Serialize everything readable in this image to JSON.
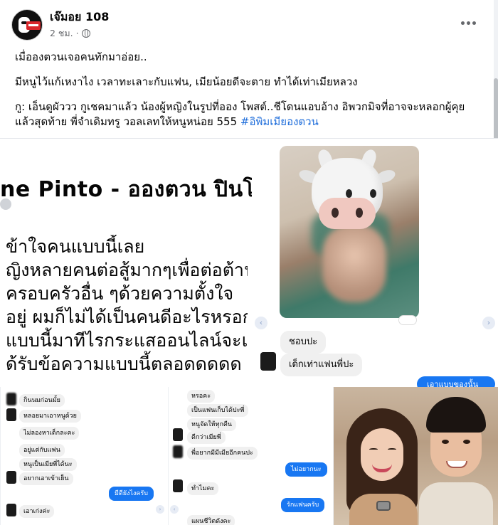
{
  "post": {
    "page_name": "เจ๊มอย 108",
    "time": "2 ชม.",
    "separator": "·",
    "line1": "เมื่อองตวนเจอคนทักมาอ่อย..",
    "line2": "มีหนูไว้แก้เหงาไง เวลาทะเลาะกับแฟน, เมียน้อยดีจะตาย ทำได้เท่าเมียหลวง",
    "line3": "กู: เอ็นดูผัววว กูเชคมาแล้ว น้องผู้หญิงในรูปที่ออง โพสต์..ชีโดนแอบอ้าง อิพวกมิจที่อาจจะหลอกผู้คุย แล้วสุดท้าย พี่จำเดิมทรู วอลเลทให้หนูหน่อย 555 ",
    "hashtag": "#อิพิมเมียองตวน"
  },
  "screenshot_top": {
    "profile_name": "ne Pinto - อองตวน ปินโต",
    "lines": [
      "ข้าใจคนแบบนี้เลย",
      "ญิงหลายคนต่อสู้มากๆเพื่อต่อต้านเ",
      "ครอบครัวอื่น ๆด้วยความตั้งใจ",
      "อยู่ ผมก็ไม่ได้เป็นคนดีอะไรหรอกแ",
      "แบบนี้มาทีไรกระแสออนไลน์จะแรง",
      "ด้รับข้อความแบบนี้ตลอดดดดด สรุ"
    ]
  },
  "chat": {
    "msg1": "ชอบปะ",
    "msg2": "เด็กเท่าแฟนพี่ปะ",
    "prev_arrow": "‹",
    "next_arrow": "›",
    "reply_partial": "เอาแบบของนั้น"
  },
  "bottom_chat_1": {
    "messages": [
      "กินนมก่อนมั้ย",
      "หลอยมาเอาหนูด้วย",
      "ไม่ลองหาเด็กละคะ",
      "อยู่แต่กับแฟน",
      "หนูเป็นเมียพี่ได้นะ",
      "อยากเอาเข้าเย็น"
    ],
    "reply": "มีดียังไงครับ",
    "last": "เอาเก่งค่ะ"
  },
  "bottom_chat_2": {
    "messages": [
      "หรอคะ",
      "เป็นแฟนเก็บได้ปะพี่",
      "หนูจัดให้ทุกคืน",
      "ดีกว่าเมียพี่",
      "พี่อยากมีมีเมียอีกคนปะ",
      "ทำไมคะ",
      "แผนชีวิตดังคะ"
    ],
    "reply1": "ไม่อยากนะ",
    "reply2": "รักแฟนครับ"
  },
  "colors": {
    "link_blue": "#216fdb",
    "messenger_blue": "#1877f2",
    "meta_gray": "#65676b"
  },
  "icons": [
    "globe-icon",
    "more-icon",
    "verified-icon",
    "cow-emoji-icon"
  ]
}
